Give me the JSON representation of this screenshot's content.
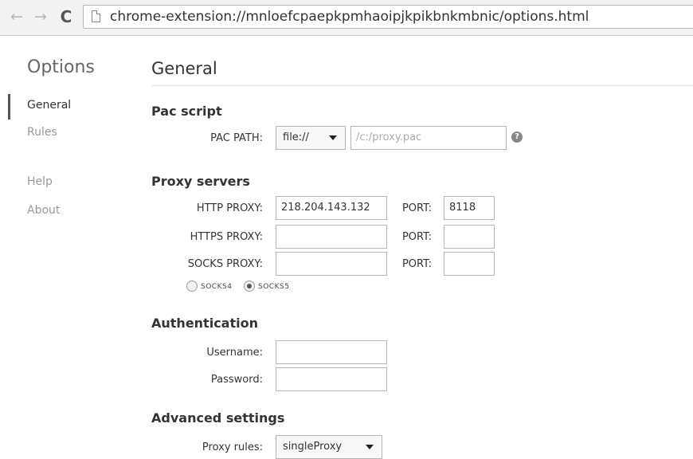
{
  "browser": {
    "back_icon": "←",
    "forward_icon": "→",
    "reload_icon": "C",
    "url": "chrome-extension://mnloefcpaepkpmhaoipjkpikbnkmbnic/options.html"
  },
  "sidebar": {
    "title": "Options",
    "items": [
      {
        "label": "General"
      },
      {
        "label": "Rules"
      },
      {
        "label": "Help"
      },
      {
        "label": "About"
      }
    ]
  },
  "main": {
    "title": "General",
    "pac": {
      "heading": "Pac script",
      "path_label": "PAC PATH:",
      "protocol_value": "file://",
      "path_placeholder": "/c:/proxy.pac",
      "help_icon": "?"
    },
    "proxy": {
      "heading": "Proxy servers",
      "port_label": "PORT:",
      "http_label": "HTTP PROXY:",
      "http_value": "218.204.143.132",
      "http_port": "8118",
      "https_label": "HTTPS PROXY:",
      "https_value": "",
      "https_port": "",
      "socks_label": "SOCKS PROXY:",
      "socks_value": "",
      "socks_port": "",
      "socks4_label": "SOCKS4",
      "socks5_label": "SOCKS5",
      "selected_socks": "SOCKS5"
    },
    "auth": {
      "heading": "Authentication",
      "username_label": "Username:",
      "password_label": "Password:",
      "username_value": "",
      "password_value": ""
    },
    "advanced": {
      "heading": "Advanced settings",
      "rules_label": "Proxy rules:",
      "rules_value": "singleProxy"
    }
  }
}
